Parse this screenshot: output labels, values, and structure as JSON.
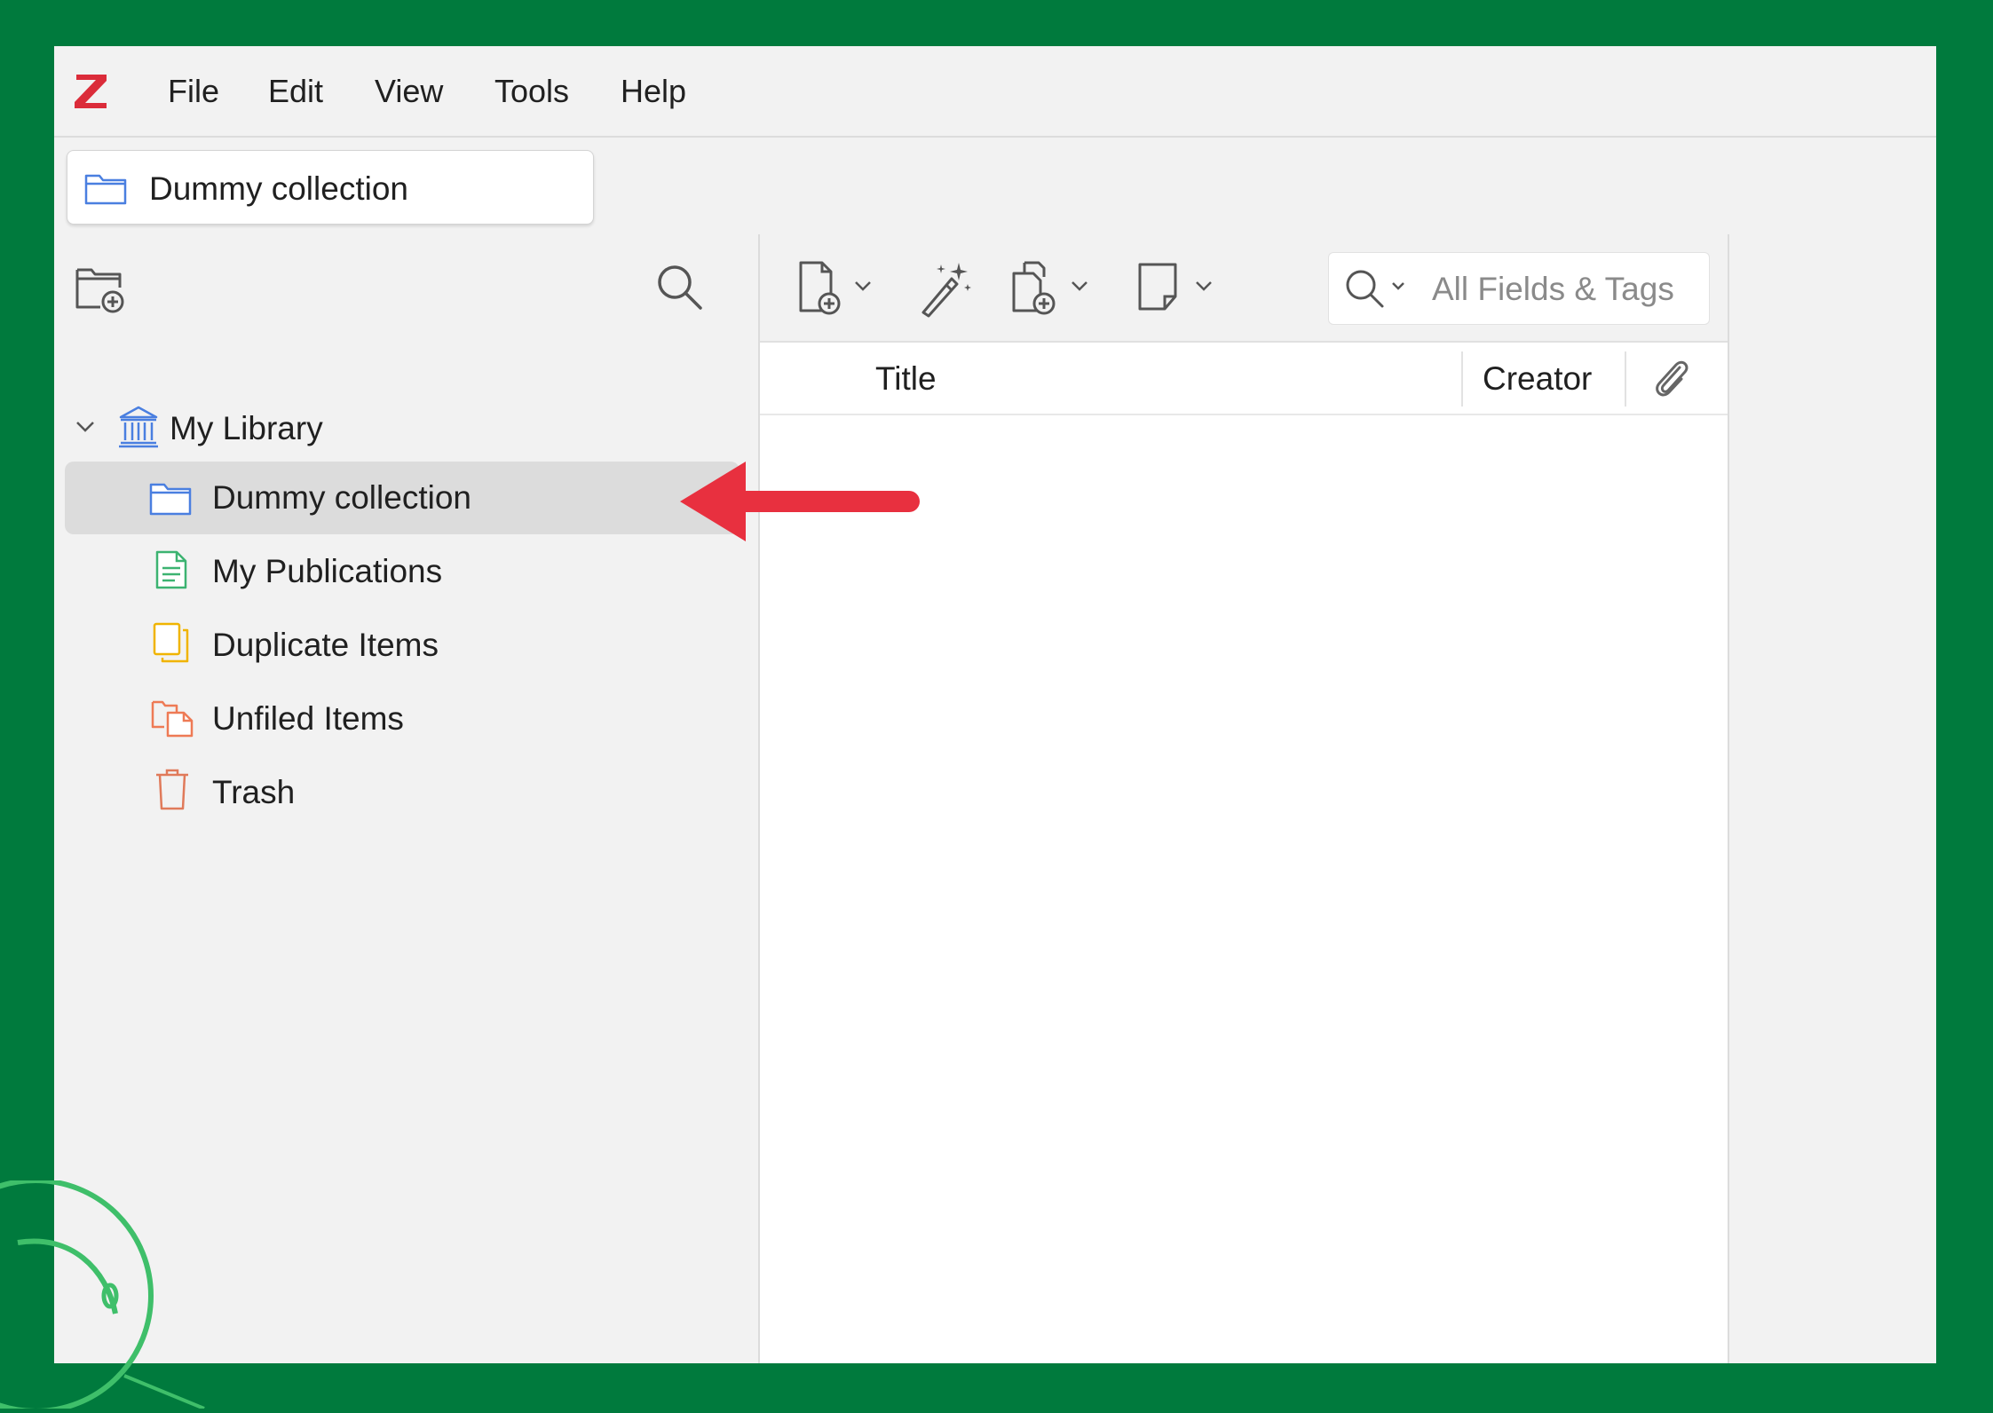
{
  "app": {
    "logo_letter": "Z",
    "brand_color": "#db2c3a"
  },
  "menu": {
    "items": [
      {
        "label": "File"
      },
      {
        "label": "Edit"
      },
      {
        "label": "View"
      },
      {
        "label": "Tools"
      },
      {
        "label": "Help"
      }
    ]
  },
  "tabs": [
    {
      "label": "Dummy collection",
      "icon": "folder-icon"
    }
  ],
  "collections": {
    "toolbar": {
      "new_collection_icon": "new-collection-icon",
      "filter_icon": "search-icon"
    },
    "tree": [
      {
        "label": "My Library",
        "icon": "library-icon",
        "expanded": true
      },
      {
        "label": "Dummy collection",
        "icon": "folder-icon",
        "selected": true
      },
      {
        "label": "My Publications",
        "icon": "publications-icon"
      },
      {
        "label": "Duplicate Items",
        "icon": "duplicate-icon"
      },
      {
        "label": "Unfiled Items",
        "icon": "unfiled-icon"
      },
      {
        "label": "Trash",
        "icon": "trash-icon"
      }
    ]
  },
  "items": {
    "toolbar": {
      "buttons": [
        "new-item-icon",
        "add-by-identifier-icon",
        "add-attachment-icon",
        "new-note-icon"
      ],
      "search_placeholder": "All Fields & Tags"
    },
    "columns": [
      {
        "label": "Title"
      },
      {
        "label": "Creator"
      },
      {
        "label": "",
        "icon": "paperclip-icon"
      }
    ],
    "rows": []
  },
  "colors": {
    "background": "#007a3d",
    "annotation_arrow": "#e8303f",
    "folder_blue": "#4a7fe0",
    "publications_green": "#3cb371",
    "duplicate_yellow": "#f0b400",
    "unfiled_orange": "#ee7a55",
    "trash_orange": "#e07a5a"
  }
}
